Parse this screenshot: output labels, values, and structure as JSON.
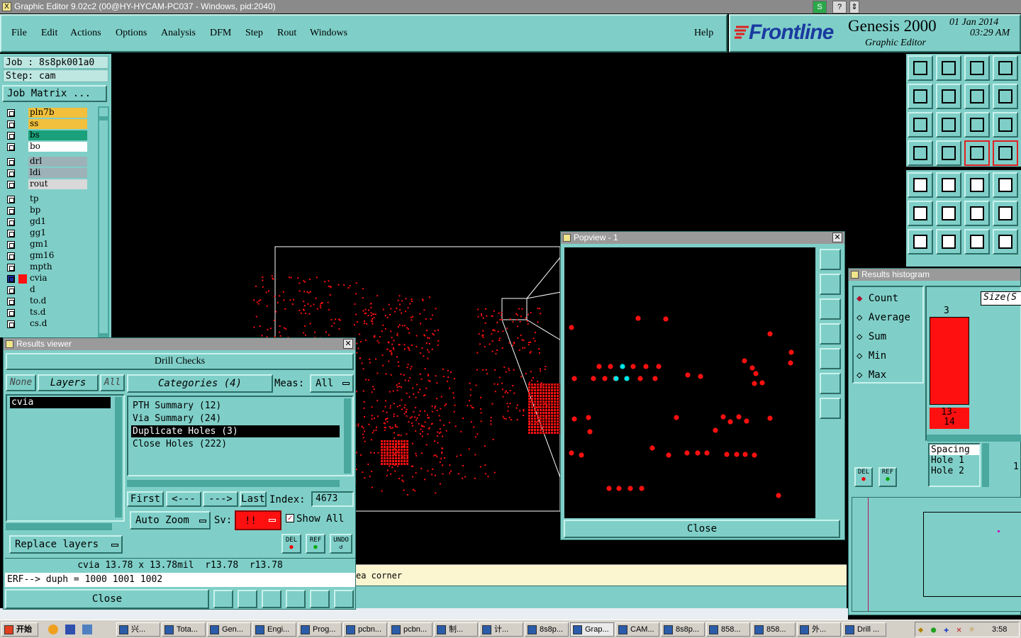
{
  "titlebar": {
    "title": "Graphic Editor 9.02c2 (00@HY-HYCAM-PC037 - Windows, pid:2040)"
  },
  "menu": {
    "items": [
      "File",
      "Edit",
      "Actions",
      "Options",
      "Analysis",
      "DFM",
      "Step",
      "Rout",
      "Windows"
    ],
    "help": "Help"
  },
  "brand": {
    "logo": "Frontline",
    "product": "Genesis 2000",
    "subtitle": "Graphic Editor",
    "date": "01 Jan 2014",
    "time": "03:29 AM"
  },
  "left": {
    "job": "Job : 8s8pk001a0",
    "step": "Step: cam",
    "job_matrix": "Job Matrix ...",
    "layers": [
      {
        "name": "pln7b",
        "color": "#f2c03c"
      },
      {
        "name": "ss",
        "color": "#f2c03c"
      },
      {
        "name": "bs",
        "color": "#1aa07a"
      },
      {
        "name": "bo",
        "color": "#ffffff"
      },
      {
        "name": "drl",
        "color": "#9cb2b8"
      },
      {
        "name": "ldi",
        "color": "#9cb2b8"
      },
      {
        "name": "rout",
        "color": "#d9d9d9"
      },
      {
        "name": "tp",
        "color": "#7fcfc8"
      },
      {
        "name": "bp",
        "color": "#7fcfc8"
      },
      {
        "name": "gd1",
        "color": "#7fcfc8"
      },
      {
        "name": "gg1",
        "color": "#7fcfc8"
      },
      {
        "name": "gm1",
        "color": "#7fcfc8"
      },
      {
        "name": "gm16",
        "color": "#7fcfc8"
      },
      {
        "name": "mpth",
        "color": "#7fcfc8"
      },
      {
        "name": "cvia",
        "color": "#7fcfc8"
      },
      {
        "name": "d",
        "color": "#7fcfc8"
      },
      {
        "name": "to.d",
        "color": "#7fcfc8"
      },
      {
        "name": "ts.d",
        "color": "#7fcfc8"
      },
      {
        "name": "cs.d",
        "color": "#7fcfc8"
      }
    ]
  },
  "results": {
    "title": "Results viewer",
    "header": "Drill Checks",
    "none": "None",
    "layers": "Layers",
    "all": "All",
    "layer_item": "cvia",
    "categories_label": "Categories (4)",
    "meas_label": "Meas:",
    "meas_value": "All",
    "categories": [
      "PTH Summary (12)",
      "Via Summary (24)",
      "Duplicate Holes (3)",
      "Close Holes (222)"
    ],
    "first": "First",
    "prev": "<---",
    "next": "--->",
    "last": "Last",
    "index_label": "Index:",
    "index_value": "4673",
    "auto_zoom": "Auto Zoom",
    "sv_label": "Sv:",
    "sv_value": "!!",
    "show_all": "Show All",
    "del": "DEL",
    "ref": "REF",
    "undo": "UNDO",
    "replace_layers": "Replace layers",
    "info": "cvia 13.78 x 13.78mil  r13.78  r13.78",
    "erf": "ERF--> duph = 1000 1001 1002",
    "close": "Close"
  },
  "popview": {
    "title": "Popview - 1",
    "close": "Close"
  },
  "histogram": {
    "title": "Results histogram",
    "modes": [
      "Count",
      "Average",
      "Sum",
      "Min",
      "Max"
    ],
    "size_label": "Size(S",
    "bar_count": "3",
    "bar_range": "13-\n14",
    "spacing_items": [
      "Spacing",
      "Hole 1",
      "Hole 2"
    ],
    "right_value": "1.",
    "del": "DEL",
    "ref": "REF"
  },
  "status": {
    "text": "ea corner"
  },
  "taskbar": {
    "start": "开始",
    "tasks": [
      "兴...",
      "Tota...",
      "Gen...",
      "Engi...",
      "Prog...",
      "pcbn...",
      "pcbn...",
      "制...",
      "计...",
      "8s8p...",
      "Grap...",
      "CAM...",
      "8s8p...",
      "858...",
      "858...",
      "外...",
      "Drill ..."
    ],
    "clock": "3:58"
  },
  "colors": {
    "panel": "#7fcfc8",
    "drill": "#ff1010",
    "highlight": "#00e6e6"
  }
}
